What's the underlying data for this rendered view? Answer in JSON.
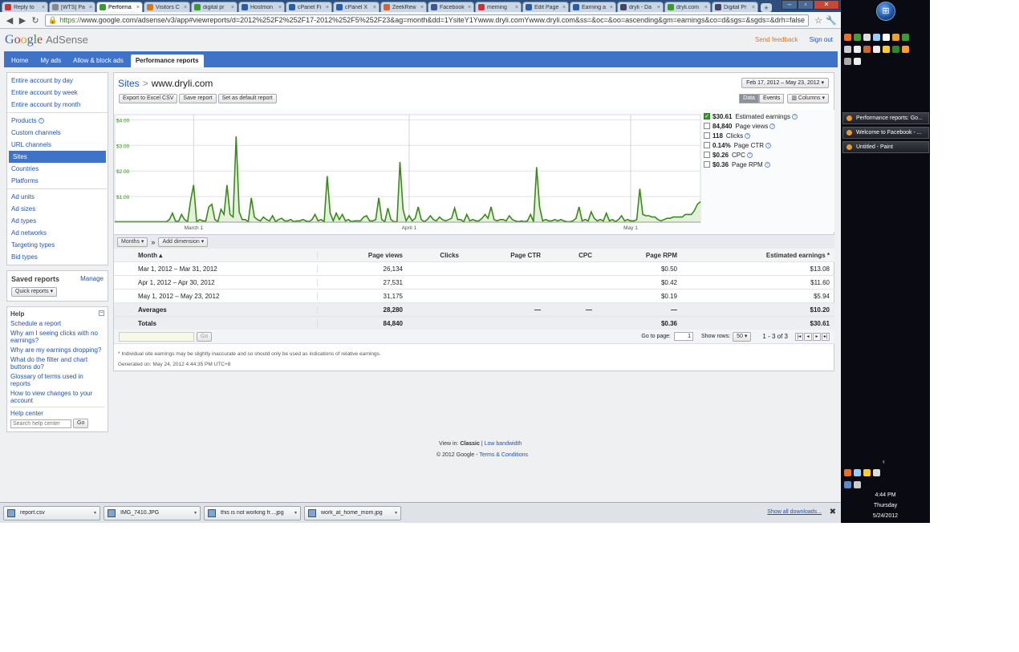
{
  "browser": {
    "tabs": [
      {
        "label": "Reply to",
        "color": "#c33"
      },
      {
        "label": "[WTS] Pa",
        "color": "#888"
      },
      {
        "label": "Performa",
        "color": "#3a9a2a",
        "active": true
      },
      {
        "label": "Visitors C",
        "color": "#d47a1c"
      },
      {
        "label": "digital pr",
        "color": "#3a9a2a"
      },
      {
        "label": "Hostmon",
        "color": "#2a5ca8"
      },
      {
        "label": "cPanel Fi",
        "color": "#2a5ca8"
      },
      {
        "label": "cPanel X",
        "color": "#2a5ca8"
      },
      {
        "label": "ZeekRew",
        "color": "#c63"
      },
      {
        "label": "Facebook",
        "color": "#3b5998"
      },
      {
        "label": "meming",
        "color": "#c33"
      },
      {
        "label": "Edit Page",
        "color": "#2a5ca8"
      },
      {
        "label": "Earning a",
        "color": "#2a5ca8"
      },
      {
        "label": "dryli - Da",
        "color": "#446"
      },
      {
        "label": "dryli.com",
        "color": "#3a9a2a"
      },
      {
        "label": "Digital Pr",
        "color": "#446"
      }
    ],
    "new_tab": "+",
    "url_https": "https://",
    "url_rest": "www.google.com/adsense/v3/app#viewreports/d=2012%252F2%252F17-2012%252F5%252F23&ag=month&dd=1YsiteY1Ywww.dryli.comYwww.dryli.com&ss=&oc=&oo=ascending&gm=earnings&co=d&sgs=&sgds=&drh=false"
  },
  "header": {
    "logo_google": "Google",
    "logo_product": "AdSense",
    "send_feedback": "Send feedback",
    "sign_out": "Sign out"
  },
  "nav": {
    "tabs": [
      "Home",
      "My ads",
      "Allow & block ads",
      "Performance reports"
    ]
  },
  "sidebar": {
    "groups": [
      [
        "Entire account by day",
        "Entire account by week",
        "Entire account by month"
      ],
      [
        "Products",
        "Custom channels",
        "URL channels",
        "Sites",
        "Countries",
        "Platforms"
      ],
      [
        "Ad units",
        "Ad sizes",
        "Ad types",
        "Ad networks",
        "Targeting types",
        "Bid types"
      ]
    ],
    "active": "Sites",
    "saved_reports": "Saved reports",
    "manage": "Manage",
    "quick_reports": "Quick reports",
    "help_title": "Help",
    "help_links": [
      "Schedule a report",
      "Why am I seeing clicks with no earnings?",
      "Why are my earnings dropping?",
      "What do the filter and chart buttons do?",
      "Glossary of terms used in reports",
      "How to view changes to your account"
    ],
    "help_center": "Help center",
    "help_search_placeholder": "Search help center",
    "go": "Go"
  },
  "report": {
    "breadcrumb_root": "Sites",
    "breadcrumb_sep": ">",
    "breadcrumb_current": "www.dryli.com",
    "date_range": "Feb 17, 2012 – May 23, 2012 ▾",
    "export_csv": "Export to Excel CSV",
    "save_report": "Save report",
    "set_default": "Set as default report",
    "view_data": "Data",
    "view_events": "Events",
    "columns": "▥ Columns ▾",
    "months_btn": "Months ▾",
    "dim_sep": "»",
    "add_dimension": "Add dimension ▾"
  },
  "metrics": [
    {
      "value": "$30.61",
      "label": "Estimated earnings",
      "checked": true
    },
    {
      "value": "84,840",
      "label": "Page views",
      "checked": false
    },
    {
      "value": "118",
      "label": "Clicks",
      "checked": false
    },
    {
      "value": "0.14%",
      "label": "Page CTR",
      "checked": false
    },
    {
      "value": "$0.26",
      "label": "CPC",
      "checked": false
    },
    {
      "value": "$0.36",
      "label": "Page RPM",
      "checked": false
    }
  ],
  "chart_data": {
    "type": "area",
    "series": [
      {
        "name": "Estimated earnings",
        "color": "#3a8a1a",
        "values": [
          0.02,
          0.02,
          0.02,
          0.02,
          0.02,
          0.02,
          0.02,
          0.02,
          0.02,
          0.02,
          0.02,
          0.02,
          0.02,
          0.02,
          0.02,
          0.02,
          0.02,
          0.02,
          0.1,
          0.35,
          0.05,
          0.02,
          0.3,
          0.1,
          0.02,
          0.85,
          1.45,
          0.02,
          0.1,
          0.05,
          0.05,
          0.6,
          0.7,
          0.1,
          0.02,
          0.5,
          0.3,
          1.45,
          0.3,
          0.2,
          3.35,
          0.4,
          0.1,
          0.1,
          0.02,
          0.95,
          0.2,
          0.1,
          0.05,
          0.2,
          0.1,
          0.05,
          0.25,
          0.02,
          0.1,
          0.15,
          0.05,
          0.05,
          0.1,
          0.02,
          0.05,
          0.05,
          0.1,
          0.05,
          0.02,
          0.1,
          0.3,
          0.05,
          0.1,
          0.02,
          1.8,
          0.35,
          0.05,
          0.35,
          0.1,
          0.3,
          0.05,
          0.1,
          0.02,
          0.05,
          0.05,
          0.05,
          0.2,
          0.25,
          0.05,
          0.05,
          0.1,
          0.95,
          0.1,
          0.02,
          0.55,
          0.1,
          0.02,
          0.02,
          2.35,
          0.5,
          0.05,
          0.25,
          0.05,
          0.15,
          0.6,
          0.1,
          0.02,
          0.1,
          0.25,
          0.1,
          0.05,
          0.2,
          0.1,
          0.05,
          0.1,
          0.15,
          0.55,
          0.1,
          0.1,
          0.02,
          0.3,
          0.05,
          0.1,
          0.05,
          0.05,
          0.15,
          0.3,
          0.15,
          0.6,
          0.1,
          0.05,
          0.1,
          0.1,
          0.05,
          0.25,
          0.1,
          0.05,
          0.02,
          0.05,
          0.02,
          0.05,
          0.3,
          0.02,
          2.15,
          0.6,
          0.05,
          0.1,
          0.05,
          0.05,
          0.1,
          0.05,
          0.1,
          0.05,
          0.02,
          0.02,
          0.05,
          0.15,
          0.6,
          0.05,
          0.1,
          0.05,
          0.4,
          0.15,
          0.05,
          0.1,
          0.05,
          0.35,
          0.05,
          0.1,
          0.02,
          0.1,
          0.25,
          0.05,
          0.1,
          0.05,
          0.05,
          0.1,
          1.3,
          0.3,
          0.25,
          0.25,
          0.2,
          0.2,
          0.1,
          0.05,
          0.1,
          0.15,
          0.15,
          0.2,
          0.2,
          0.2,
          0.2,
          0.3,
          0.3,
          0.3,
          0.45,
          0.7,
          0.8
        ]
      }
    ],
    "y_ticks": [
      "$4.00",
      "$3.00",
      "$2.00",
      "$1.00"
    ],
    "y_tick_values": [
      4,
      3,
      2,
      1
    ],
    "ylim": [
      0,
      4.2
    ],
    "x_ticks": [
      "March 1",
      "April 1",
      "May 1"
    ],
    "x_tick_index": [
      26,
      97,
      170
    ],
    "grid": true
  },
  "table": {
    "columns": [
      "Month ▴",
      "Page views",
      "Clicks",
      "Page CTR",
      "CPC",
      "Page RPM",
      "Estimated earnings *"
    ],
    "rows": [
      [
        "Mar 1, 2012 – Mar 31, 2012",
        "26,134",
        "",
        "",
        "",
        "$0.50",
        "$13.08"
      ],
      [
        "Apr 1, 2012 – Apr 30, 2012",
        "27,531",
        "",
        "",
        "",
        "$0.42",
        "$11.60"
      ],
      [
        "May 1, 2012 – May 23, 2012",
        "31,175",
        "",
        "",
        "",
        "$0.19",
        "$5.94"
      ]
    ],
    "averages": [
      "Averages",
      "28,280",
      "",
      "—",
      "—",
      "—",
      "$10.20"
    ],
    "totals": [
      "Totals",
      "84,840",
      "",
      "",
      "",
      "$0.36",
      "$30.61"
    ]
  },
  "pager": {
    "go": "Go",
    "go_to_page": "Go to page:",
    "page_value": "1",
    "show_rows": "Show rows:",
    "rows_value": "50 ▾",
    "range": "1 - 3 of 3",
    "first": "|◂",
    "prev": "◂",
    "next": "▸",
    "last": "▸|"
  },
  "footnote": {
    "line1": "* Individual site earnings may be slightly inaccurate and so should only be used as indications of relative earnings.",
    "line2": "Generated on: May 24, 2012 4:44:35 PM UTC+8"
  },
  "footer": {
    "view_in": "View in:",
    "classic": "Classic",
    "sep": "|",
    "low_bandwidth": "Low bandwidth",
    "copyright": "© 2012 Google -",
    "terms": "Terms & Conditions"
  },
  "downloads": {
    "items": [
      "report.csv",
      "IMG_7410.JPG",
      "this is not working fr....jpg",
      "work_at_home_mom.jpg"
    ],
    "show_all": "Show all downloads...",
    "close": "✖"
  },
  "desktop": {
    "tasks": [
      "Performance reports: Go...",
      "Welcome to Facebook - ...",
      "Untitled - Paint"
    ],
    "time": "4:44 PM",
    "day": "Thursday",
    "date": "5/24/2012",
    "expand": "‹"
  }
}
